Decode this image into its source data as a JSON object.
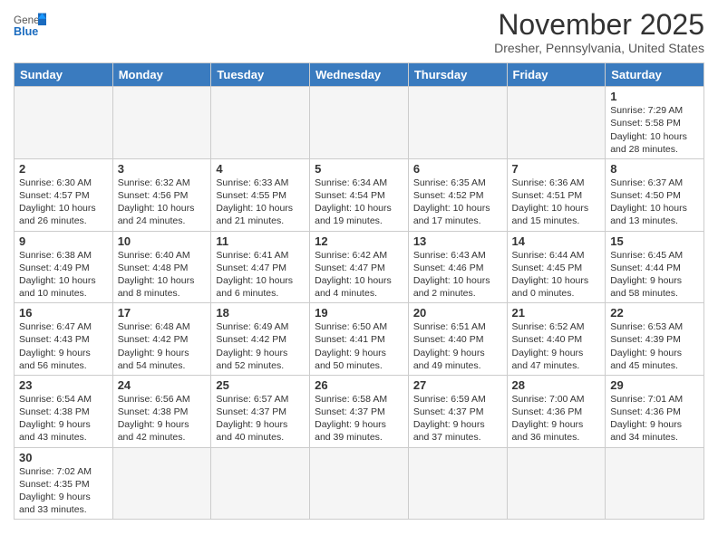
{
  "header": {
    "logo_general": "General",
    "logo_blue": "Blue",
    "title": "November 2025",
    "subtitle": "Dresher, Pennsylvania, United States"
  },
  "weekdays": [
    "Sunday",
    "Monday",
    "Tuesday",
    "Wednesday",
    "Thursday",
    "Friday",
    "Saturday"
  ],
  "weeks": [
    [
      {
        "day": "",
        "info": ""
      },
      {
        "day": "",
        "info": ""
      },
      {
        "day": "",
        "info": ""
      },
      {
        "day": "",
        "info": ""
      },
      {
        "day": "",
        "info": ""
      },
      {
        "day": "",
        "info": ""
      },
      {
        "day": "1",
        "info": "Sunrise: 7:29 AM\nSunset: 5:58 PM\nDaylight: 10 hours\nand 28 minutes."
      }
    ],
    [
      {
        "day": "2",
        "info": "Sunrise: 6:30 AM\nSunset: 4:57 PM\nDaylight: 10 hours\nand 26 minutes."
      },
      {
        "day": "3",
        "info": "Sunrise: 6:32 AM\nSunset: 4:56 PM\nDaylight: 10 hours\nand 24 minutes."
      },
      {
        "day": "4",
        "info": "Sunrise: 6:33 AM\nSunset: 4:55 PM\nDaylight: 10 hours\nand 21 minutes."
      },
      {
        "day": "5",
        "info": "Sunrise: 6:34 AM\nSunset: 4:54 PM\nDaylight: 10 hours\nand 19 minutes."
      },
      {
        "day": "6",
        "info": "Sunrise: 6:35 AM\nSunset: 4:52 PM\nDaylight: 10 hours\nand 17 minutes."
      },
      {
        "day": "7",
        "info": "Sunrise: 6:36 AM\nSunset: 4:51 PM\nDaylight: 10 hours\nand 15 minutes."
      },
      {
        "day": "8",
        "info": "Sunrise: 6:37 AM\nSunset: 4:50 PM\nDaylight: 10 hours\nand 13 minutes."
      }
    ],
    [
      {
        "day": "9",
        "info": "Sunrise: 6:38 AM\nSunset: 4:49 PM\nDaylight: 10 hours\nand 10 minutes."
      },
      {
        "day": "10",
        "info": "Sunrise: 6:40 AM\nSunset: 4:48 PM\nDaylight: 10 hours\nand 8 minutes."
      },
      {
        "day": "11",
        "info": "Sunrise: 6:41 AM\nSunset: 4:47 PM\nDaylight: 10 hours\nand 6 minutes."
      },
      {
        "day": "12",
        "info": "Sunrise: 6:42 AM\nSunset: 4:47 PM\nDaylight: 10 hours\nand 4 minutes."
      },
      {
        "day": "13",
        "info": "Sunrise: 6:43 AM\nSunset: 4:46 PM\nDaylight: 10 hours\nand 2 minutes."
      },
      {
        "day": "14",
        "info": "Sunrise: 6:44 AM\nSunset: 4:45 PM\nDaylight: 10 hours\nand 0 minutes."
      },
      {
        "day": "15",
        "info": "Sunrise: 6:45 AM\nSunset: 4:44 PM\nDaylight: 9 hours\nand 58 minutes."
      }
    ],
    [
      {
        "day": "16",
        "info": "Sunrise: 6:47 AM\nSunset: 4:43 PM\nDaylight: 9 hours\nand 56 minutes."
      },
      {
        "day": "17",
        "info": "Sunrise: 6:48 AM\nSunset: 4:42 PM\nDaylight: 9 hours\nand 54 minutes."
      },
      {
        "day": "18",
        "info": "Sunrise: 6:49 AM\nSunset: 4:42 PM\nDaylight: 9 hours\nand 52 minutes."
      },
      {
        "day": "19",
        "info": "Sunrise: 6:50 AM\nSunset: 4:41 PM\nDaylight: 9 hours\nand 50 minutes."
      },
      {
        "day": "20",
        "info": "Sunrise: 6:51 AM\nSunset: 4:40 PM\nDaylight: 9 hours\nand 49 minutes."
      },
      {
        "day": "21",
        "info": "Sunrise: 6:52 AM\nSunset: 4:40 PM\nDaylight: 9 hours\nand 47 minutes."
      },
      {
        "day": "22",
        "info": "Sunrise: 6:53 AM\nSunset: 4:39 PM\nDaylight: 9 hours\nand 45 minutes."
      }
    ],
    [
      {
        "day": "23",
        "info": "Sunrise: 6:54 AM\nSunset: 4:38 PM\nDaylight: 9 hours\nand 43 minutes."
      },
      {
        "day": "24",
        "info": "Sunrise: 6:56 AM\nSunset: 4:38 PM\nDaylight: 9 hours\nand 42 minutes."
      },
      {
        "day": "25",
        "info": "Sunrise: 6:57 AM\nSunset: 4:37 PM\nDaylight: 9 hours\nand 40 minutes."
      },
      {
        "day": "26",
        "info": "Sunrise: 6:58 AM\nSunset: 4:37 PM\nDaylight: 9 hours\nand 39 minutes."
      },
      {
        "day": "27",
        "info": "Sunrise: 6:59 AM\nSunset: 4:37 PM\nDaylight: 9 hours\nand 37 minutes."
      },
      {
        "day": "28",
        "info": "Sunrise: 7:00 AM\nSunset: 4:36 PM\nDaylight: 9 hours\nand 36 minutes."
      },
      {
        "day": "29",
        "info": "Sunrise: 7:01 AM\nSunset: 4:36 PM\nDaylight: 9 hours\nand 34 minutes."
      }
    ],
    [
      {
        "day": "30",
        "info": "Sunrise: 7:02 AM\nSunset: 4:35 PM\nDaylight: 9 hours\nand 33 minutes."
      },
      {
        "day": "",
        "info": ""
      },
      {
        "day": "",
        "info": ""
      },
      {
        "day": "",
        "info": ""
      },
      {
        "day": "",
        "info": ""
      },
      {
        "day": "",
        "info": ""
      },
      {
        "day": "",
        "info": ""
      }
    ]
  ]
}
